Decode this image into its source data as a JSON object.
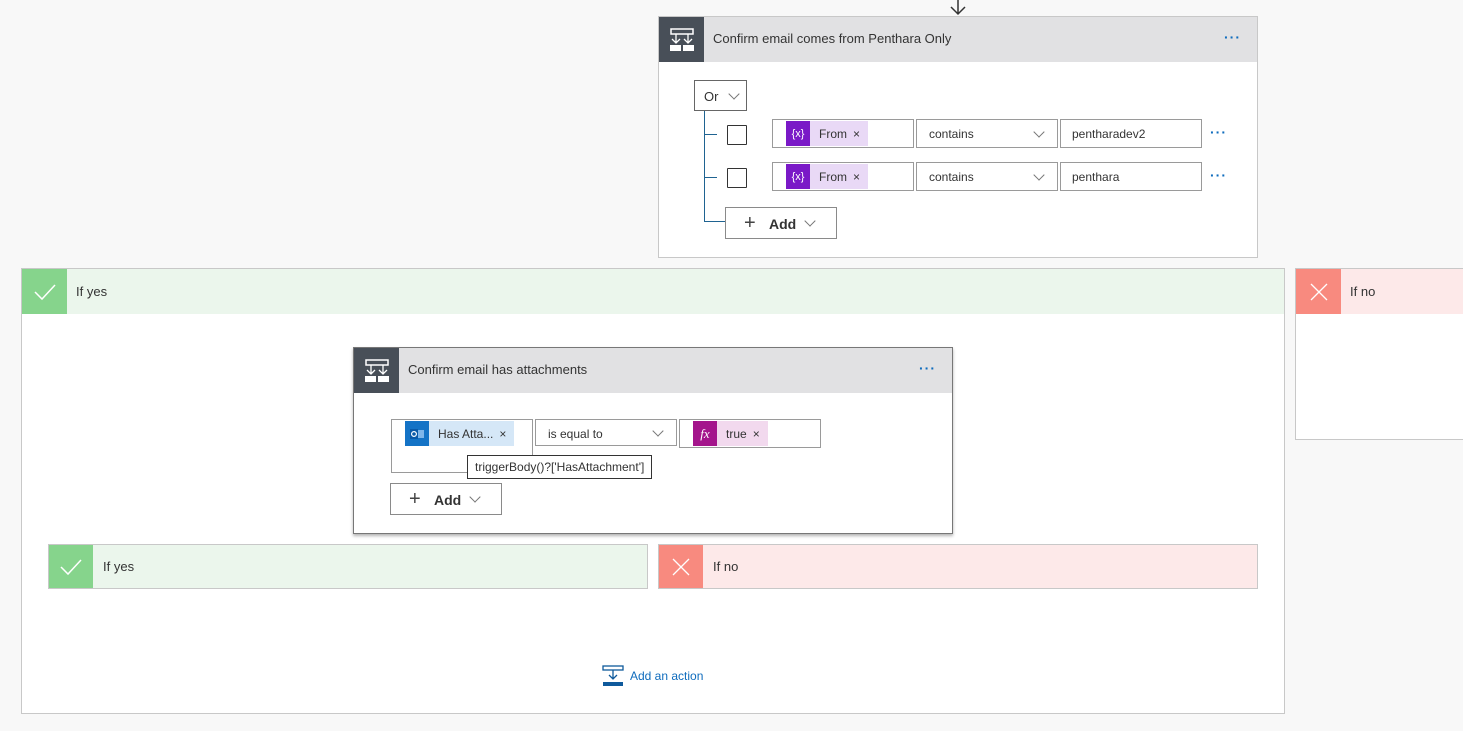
{
  "top_condition": {
    "title": "Confirm email comes from Penthara Only",
    "group_operator": "Or",
    "rows": [
      {
        "token": "From",
        "token_icon": "variable-icon",
        "operator": "contains",
        "value": "pentharadev2"
      },
      {
        "token": "From",
        "token_icon": "variable-icon",
        "operator": "contains",
        "value": "penthara"
      }
    ],
    "add_label": "Add"
  },
  "outer_yes": {
    "label": "If yes",
    "inner_condition": {
      "title": "Confirm email has attachments",
      "row": {
        "token": "Has Atta...",
        "token_icon": "outlook-icon",
        "operator": "is equal to",
        "value_token": "true",
        "value_icon": "fx-icon"
      },
      "tooltip": "triggerBody()?['HasAttachment']",
      "add_label": "Add"
    },
    "inner_yes_label": "If yes",
    "inner_no_label": "If no",
    "add_action_label": "Add an action"
  },
  "outer_no": {
    "label": "If no"
  },
  "colors": {
    "header_icon_bg": "#484f58",
    "variable_token": "#7a19c7",
    "variable_token_bg": "#e9d9f6",
    "outlook_token": "#1473c6",
    "outlook_token_bg": "#d5e7f7",
    "fx_token": "#a4158c",
    "fx_token_bg": "#f2d9ee",
    "yes_green": "#86d48c",
    "no_red": "#f88a7f",
    "link_blue": "#0f6cbd"
  }
}
